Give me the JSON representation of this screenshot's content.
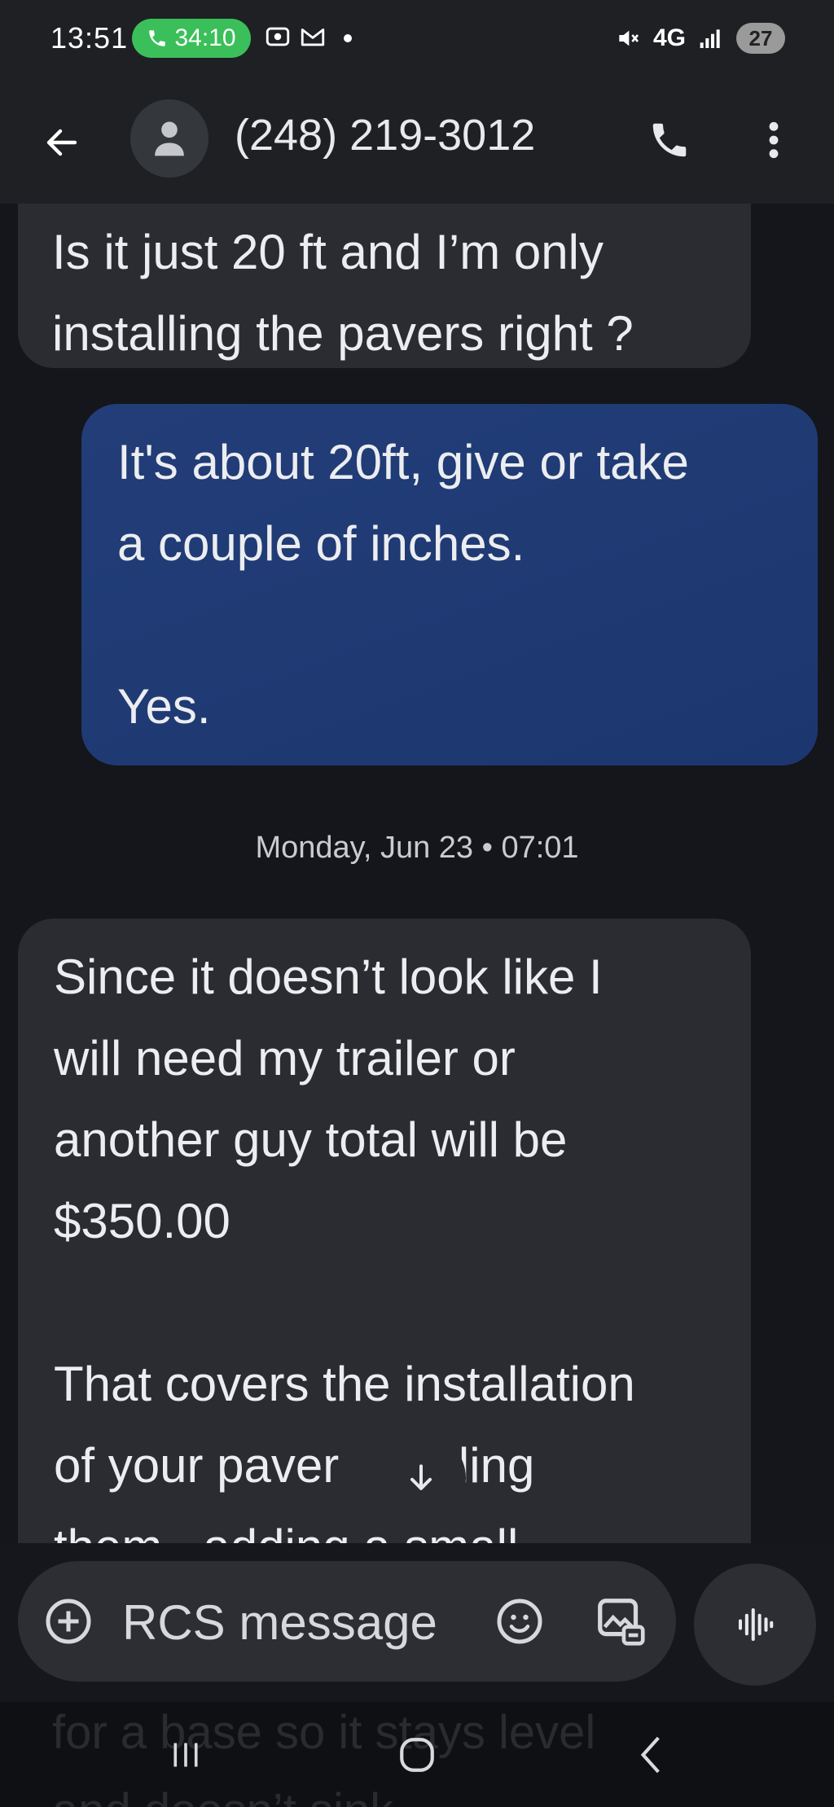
{
  "status_bar": {
    "time": "13:51",
    "call_timer": "34:10",
    "network": "4G",
    "battery": "27",
    "colors": {
      "call_pill": "#3bbf5a"
    }
  },
  "app_bar": {
    "title": "(248) 219-3012",
    "icons": {
      "back": "arrow-back-icon",
      "avatar": "person-icon",
      "call": "phone-icon",
      "more": "more-vert-icon"
    }
  },
  "messages": [
    {
      "direction": "incoming",
      "text": "Is it just 20 ft and I’m only\ninstalling the pavers right ?"
    },
    {
      "direction": "outgoing",
      "text": "It's about 20ft, give or take\na couple of inches.\n\nYes."
    },
    {
      "direction": "incoming",
      "text": "Since it doesn’t look like I\nwill need my trailer or\nanother guy total will be\n$350.00\n\nThat covers the installation\nof your paver   eveling\nthem , adding a small"
    }
  ],
  "date_separator": "Monday, Jun 23 • 07:01",
  "composer": {
    "placeholder": "RCS message",
    "icons": {
      "add": "plus-circle-icon",
      "emoji": "emoji-icon",
      "gallery": "gallery-icon",
      "voice": "voice-waveform-icon"
    }
  },
  "hidden_text_under_nav": "for a base so it stays level\nand doesn’t sink",
  "nav": {
    "icons": {
      "recents": "recents-icon",
      "home": "home-icon",
      "back": "nav-back-icon"
    }
  },
  "colors": {
    "background": "#14161b",
    "incoming_bubble": "#2a2c31",
    "outgoing_bubble": "#1f3a73"
  }
}
